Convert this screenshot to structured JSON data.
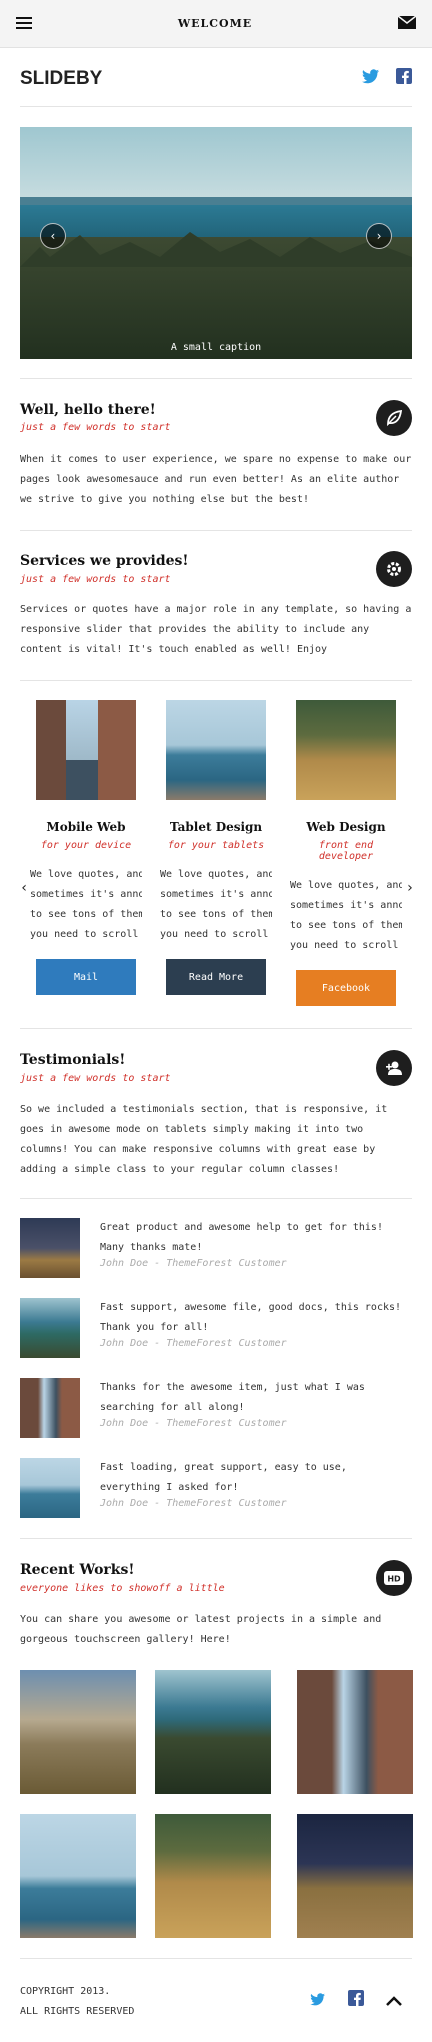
{
  "header": {
    "title": "WELCOME",
    "menu_icon": "hamburger-icon",
    "mail_icon": "envelope-icon"
  },
  "brand": {
    "name": "SLIDEBY",
    "social": [
      "twitter-icon",
      "facebook-icon"
    ]
  },
  "slider": {
    "caption": "A small caption",
    "prev_icon": "chevron-left-icon",
    "next_icon": "chevron-right-icon"
  },
  "intro": {
    "title": "Well, hello there!",
    "subtitle": "just a few words to start",
    "text": "When it comes to user experience, we spare no expense to make our pages look awesomesauce and run even better! As an elite author we strive to give you nothing else but the best!",
    "icon": "leaf-icon"
  },
  "services": {
    "title": "Services we provides!",
    "subtitle": "just a few words to start",
    "text": "Services or quotes have a major role in any template, so having a responsive slider that provides the ability to include any content is vital! It's touch enabled as well! Enjoy",
    "icon": "gear-icon",
    "cards": [
      {
        "title": "Mobile Web",
        "subtitle": "for your device",
        "line1": "We love quotes, and",
        "line2": "sometimes it's annoyi",
        "line3": "to see tons of them t",
        "line4": "you need to scroll t",
        "button": "Mail",
        "color": "#2f7bbd"
      },
      {
        "title": "Tablet Design",
        "subtitle": "for your tablets",
        "line1": "We love quotes, and",
        "line2": "sometimes it's annoyi",
        "line3": "to see tons of them t",
        "line4": "you need to scroll t",
        "button": "Read More",
        "color": "#2c3e50"
      },
      {
        "title": "Web Design",
        "subtitle": "front end developer",
        "line1": "We love quotes, and",
        "line2": "sometimes it's annoyi",
        "line3": "to see tons of them t",
        "line4": "you need to scroll t",
        "button": "Facebook",
        "color": "#e67e22"
      }
    ]
  },
  "testimonials": {
    "title": "Testimonials!",
    "subtitle": "just a few words to start",
    "text": "So we included a testimonials section, that is responsive, it goes in awesome mode on tablets simply making it into two columns! You can make responsive columns with great ease by adding a simple class to your regular column classes!",
    "icon": "add-user-icon",
    "items": [
      {
        "quote": "Great product and awesome help to get for this! Many thanks mate!",
        "author": "John Doe - ThemeForest Customer"
      },
      {
        "quote": "Fast support, awesome file, good docs, this rocks! Thank you for all!",
        "author": "John Doe - ThemeForest Customer"
      },
      {
        "quote": "Thanks for the awesome item, just what I was searching for all along!",
        "author": "John Doe - ThemeForest Customer"
      },
      {
        "quote": "Fast loading, great support, easy to use, everything I asked for!",
        "author": "John Doe - ThemeForest Customer"
      }
    ]
  },
  "works": {
    "title": "Recent Works!",
    "subtitle": "everyone likes to showoff a little",
    "text": "You can share you awesome or latest projects in a simple and gorgeous touchscreen gallery! Here!",
    "icon": "hd-icon"
  },
  "footer": {
    "line1": "COPYRIGHT 2013.",
    "line2": "ALL RIGHTS RESERVED",
    "icons": [
      "twitter-icon",
      "facebook-icon",
      "chevron-up-icon"
    ]
  }
}
